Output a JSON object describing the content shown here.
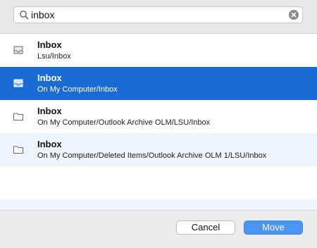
{
  "search": {
    "value": "inbox",
    "icon": "search-icon",
    "clear_icon": "clear-icon"
  },
  "results": [
    {
      "name": "Inbox",
      "path": "Lsu/Inbox",
      "icon": "inbox-tray-icon",
      "selected": false
    },
    {
      "name": "Inbox",
      "path": "On My Computer/Inbox",
      "icon": "inbox-tray-icon",
      "selected": true
    },
    {
      "name": "Inbox",
      "path": "On My Computer/Outlook Archive OLM/LSU/Inbox",
      "icon": "folder-icon",
      "selected": false
    },
    {
      "name": "Inbox",
      "path": "On My Computer/Deleted Items/Outlook Archive OLM 1/LSU/Inbox",
      "icon": "folder-icon",
      "selected": false
    }
  ],
  "buttons": {
    "cancel": "Cancel",
    "move": "Move"
  },
  "colors": {
    "selection": "#1a6bd4",
    "primary_button": "#4a94f4",
    "alt_row": "#eef4fd"
  }
}
